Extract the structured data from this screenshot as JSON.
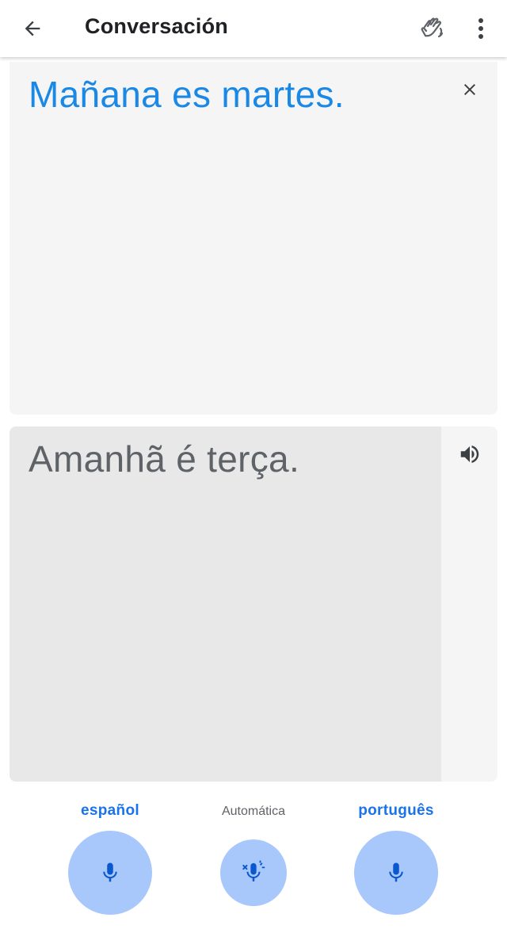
{
  "appbar": {
    "title": "Conversación",
    "icons": {
      "back": "arrow-back-icon",
      "hands": "waving-hands-icon",
      "more": "more-vert-icon"
    }
  },
  "source": {
    "text": "Mañana es martes.",
    "color": "#1a88e5",
    "close_icon": "close-icon"
  },
  "target": {
    "text": "Amanhã é terça.",
    "speaker_icon": "volume-up-icon"
  },
  "controls": {
    "left_language": "español",
    "auto_label": "Automática",
    "right_language": "português",
    "mic_color": "#a8c7fa",
    "accent_color": "#1a73e8"
  }
}
